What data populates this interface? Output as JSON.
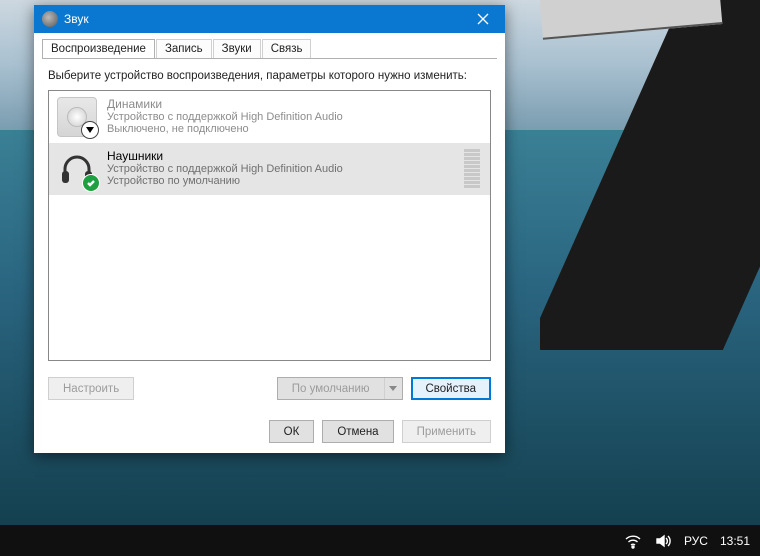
{
  "window": {
    "title": "Звук",
    "instruction": "Выберите устройство воспроизведения, параметры которого нужно изменить:"
  },
  "tabs": [
    {
      "label": "Воспроизведение",
      "active": true
    },
    {
      "label": "Запись"
    },
    {
      "label": "Звуки"
    },
    {
      "label": "Связь"
    }
  ],
  "devices": [
    {
      "name": "Динамики",
      "desc": "Устройство с поддержкой High Definition Audio",
      "status": "Выключено, не подключено"
    },
    {
      "name": "Наушники",
      "desc": "Устройство с поддержкой High Definition Audio",
      "status": "Устройство по умолчанию"
    }
  ],
  "buttons": {
    "configure": "Настроить",
    "set_default": "По умолчанию",
    "properties": "Свойства",
    "ok": "ОК",
    "cancel": "Отмена",
    "apply": "Применить"
  },
  "taskbar": {
    "lang": "РУС",
    "time": "13:51"
  }
}
